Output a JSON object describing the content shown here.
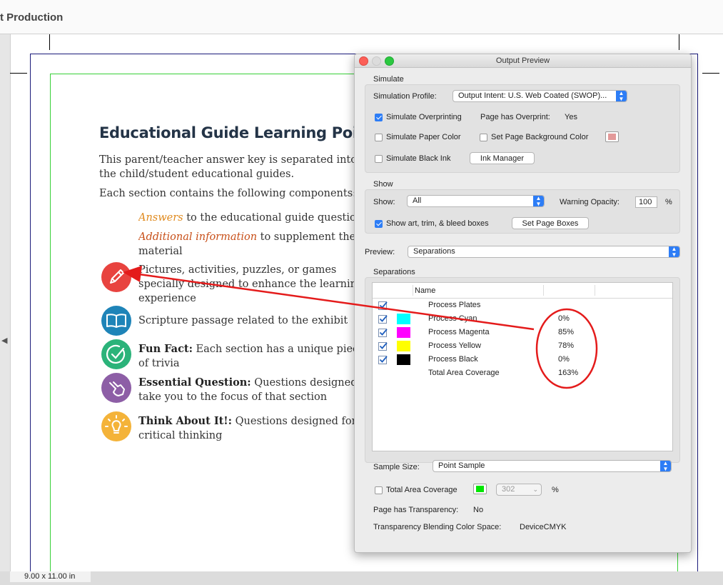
{
  "app": {
    "title": "t Production"
  },
  "status": {
    "page_size": "9.00 x 11.00 in"
  },
  "document": {
    "title": "Educational Guide Learning Points",
    "intro_line1": "This parent/teacher answer key is separated into sec",
    "intro_line2": "the child/student educational guides.",
    "components_line": "Each section contains the following components:",
    "answers_em": "Answers",
    "answers_rest": " to the educational guide questions",
    "additional_em": "Additional information",
    "additional_rest": " to supplement the",
    "additional_line2": "material",
    "pictures_line1": "Pictures, activities, puzzles, or games",
    "pictures_line2": "specially designed to enhance the learning",
    "pictures_line3": "experience",
    "scripture_line": "Scripture passage related to the exhibit",
    "funfact_bold": "Fun Fact:",
    "funfact_rest": " Each section has a unique piece",
    "funfact_line2": "of trivia",
    "essential_bold": "Essential Question:",
    "essential_rest": " Questions designed to",
    "essential_line2": "take you to the focus of that section",
    "think_bold": "Think About It!:",
    "think_rest": " Questions designed for",
    "think_line2": "critical thinking",
    "icon_colors": {
      "pencil": "#e8433f",
      "book": "#1e84b8",
      "check": "#2bb37a",
      "hand": "#8d5ea6",
      "bulb": "#f4b339"
    }
  },
  "dialog": {
    "title": "Output Preview",
    "simulate_label": "Simulate",
    "simulation_profile_label": "Simulation Profile:",
    "simulation_profile_value": "Output Intent: U.S. Web Coated (SWOP)...",
    "simulate_overprinting": "Simulate Overprinting",
    "page_has_overprint_label": "Page has Overprint:",
    "page_has_overprint_value": "Yes",
    "simulate_paper_color": "Simulate Paper Color",
    "set_page_background_color": "Set Page Background Color",
    "simulate_black_ink": "Simulate Black Ink",
    "ink_manager": "Ink Manager",
    "show_section": "Show",
    "show_label": "Show:",
    "show_value": "All",
    "warning_opacity_label": "Warning Opacity:",
    "warning_opacity_value": "100",
    "percent": "%",
    "show_boxes": "Show art, trim, & bleed boxes",
    "set_page_boxes": "Set Page Boxes",
    "preview_label": "Preview:",
    "preview_value": "Separations",
    "separations_label": "Separations",
    "name_header": "Name",
    "plates": [
      {
        "name": "Process Plates",
        "value": "",
        "color": ""
      },
      {
        "name": "Process Cyan",
        "value": "0%",
        "color": "#00ffff"
      },
      {
        "name": "Process Magenta",
        "value": "85%",
        "color": "#ff00ff"
      },
      {
        "name": "Process Yellow",
        "value": "78%",
        "color": "#ffff00"
      },
      {
        "name": "Process Black",
        "value": "0%",
        "color": "#000000"
      },
      {
        "name": "Total Area Coverage",
        "value": "163%",
        "color": ""
      }
    ],
    "sample_size_label": "Sample Size:",
    "sample_size_value": "Point Sample",
    "total_area_coverage": "Total Area Coverage",
    "tac_value": "302",
    "tac_percent": "%",
    "page_has_transparency_label": "Page has Transparency:",
    "page_has_transparency_value": "No",
    "transparency_space_label": "Transparency Blending Color Space:",
    "transparency_space_value": "DeviceCMYK",
    "colors": {
      "accent": "#2d7df6",
      "page_bg_swatch": "#e39a9a",
      "tac_swatch": "#00e600"
    }
  },
  "annotation": {
    "color": "#e41b1b"
  }
}
